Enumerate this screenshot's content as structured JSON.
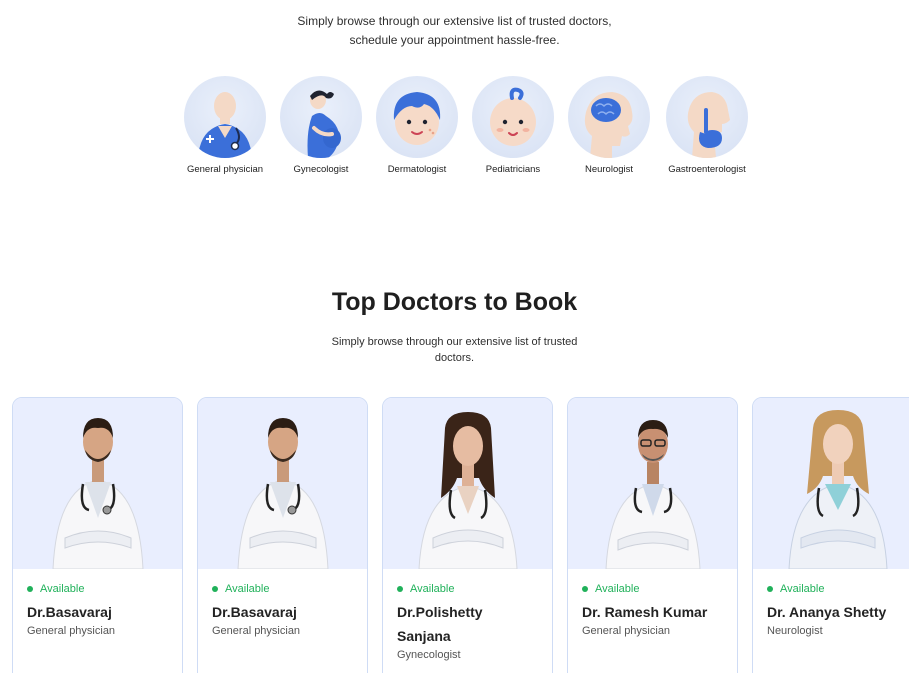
{
  "intro": {
    "line1": "Simply browse through our extensive list of trusted doctors,",
    "line2": "schedule your appointment hassle-free."
  },
  "specialities": [
    {
      "label": "General physician",
      "icon": "general-physician-icon"
    },
    {
      "label": "Gynecologist",
      "icon": "gynecologist-icon"
    },
    {
      "label": "Dermatologist",
      "icon": "dermatologist-icon"
    },
    {
      "label": "Pediatricians",
      "icon": "pediatrician-icon"
    },
    {
      "label": "Neurologist",
      "icon": "neurologist-icon"
    },
    {
      "label": "Gastroenterologist",
      "icon": "gastroenterologist-icon"
    }
  ],
  "top_doctors": {
    "title": "Top Doctors to Book",
    "sub_line1": "Simply browse through our extensive list of trusted",
    "sub_line2": "doctors."
  },
  "doctors": [
    {
      "status": "Available",
      "name": "Dr.Basavaraj",
      "speciality": "General physician"
    },
    {
      "status": "Available",
      "name": "Dr.Basavaraj",
      "speciality": "General physician"
    },
    {
      "status": "Available",
      "name_line1": "Dr.Polishetty",
      "name_line2": "Sanjana",
      "speciality": "Gynecologist"
    },
    {
      "status": "Available",
      "name": "Dr. Ramesh Kumar",
      "speciality": "General physician"
    },
    {
      "status": "Available",
      "name": "Dr. Ananya Shetty",
      "speciality": "Neurologist"
    }
  ],
  "colors": {
    "accent_green": "#20b15a",
    "card_bg": "#e9eefe",
    "card_border": "#cfdcf5",
    "icon_blue": "#3b6fd9"
  }
}
